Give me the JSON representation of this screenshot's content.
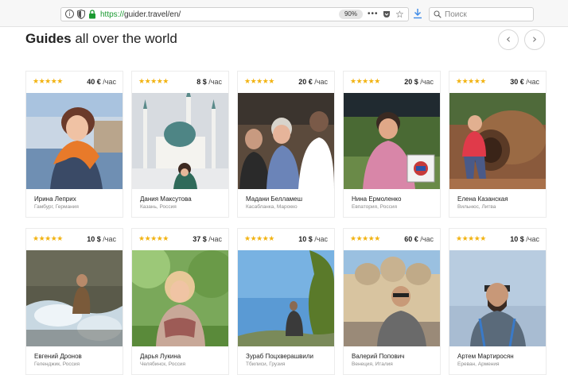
{
  "browser": {
    "url_scheme": "https://",
    "url_rest": "guider.travel/en/",
    "zoom": "90%",
    "more_label": "•••",
    "star_label": "☆",
    "search_placeholder": "Поиск",
    "info_label": "i"
  },
  "header": {
    "title_bold": "Guides",
    "title_rest": " all over the world",
    "prev_label": "‹",
    "next_label": "›"
  },
  "colors": {
    "star": "#f2b312",
    "secure": "#1a9a30"
  },
  "guides": [
    {
      "stars": "★★★★★",
      "price": "40 €",
      "unit": " /час",
      "name": "Ирина Леприх",
      "location": "Гамбург, Германия"
    },
    {
      "stars": "★★★★★",
      "price": "8 $",
      "unit": " /час",
      "name": "Дания Максутова",
      "location": "Казань, Россия"
    },
    {
      "stars": "★★★★★",
      "price": "20 €",
      "unit": " /час",
      "name": "Мадани Белламеш",
      "location": "Касабланка, Марокко"
    },
    {
      "stars": "★★★★★",
      "price": "20 $",
      "unit": " /час",
      "name": "Нина Ермоленко",
      "location": "Евпатория, Россия"
    },
    {
      "stars": "★★★★★",
      "price": "30 €",
      "unit": " /час",
      "name": "Елена Казанская",
      "location": "Вильнюс, Литва"
    },
    {
      "stars": "★★★★★",
      "price": "10 $",
      "unit": " /час",
      "name": "Евгений Дронов",
      "location": "Геленджик, Россия"
    },
    {
      "stars": "★★★★★",
      "price": "37 $",
      "unit": " /час",
      "name": "Дарья Лукина",
      "location": "Челябинск, Россия"
    },
    {
      "stars": "★★★★★",
      "price": "10 $",
      "unit": " /час",
      "name": "Зураб Поцхверашвили",
      "location": "Тбилиси, Грузия"
    },
    {
      "stars": "★★★★★",
      "price": "60 €",
      "unit": " /час",
      "name": "Валерий Попович",
      "location": "Венеция, Италия"
    },
    {
      "stars": "★★★★★",
      "price": "10 $",
      "unit": " /час",
      "name": "Артем Мартиросян",
      "location": "Ереван, Армения"
    }
  ]
}
